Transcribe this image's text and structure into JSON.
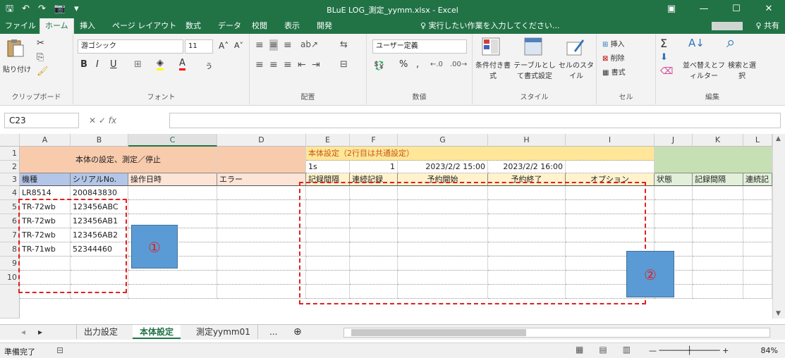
{
  "title": "BLuE LOG_測定_yymm.xlsx - Excel",
  "qat": {
    "save": "🖫",
    "undo": "↶",
    "redo": "↷",
    "camera": "📷",
    "more": "▾"
  },
  "window": {
    "restore_icon": "▣",
    "min": "—",
    "max": "☐",
    "close": "✕"
  },
  "tabs": [
    "ファイル",
    "ホーム",
    "挿入",
    "ページ レイアウト",
    "数式",
    "データ",
    "校閲",
    "表示",
    "開発"
  ],
  "active_tab": "ホーム",
  "tellme": "♀ 実行したい作業を入力してください...",
  "share": "♀ 共有",
  "ribbon": {
    "paste": "貼り付け",
    "clipboard": "クリップボード",
    "font_name": "游ゴシック",
    "font_size": "11",
    "font_group": "フォント",
    "bold": "B",
    "italic": "I",
    "underline": "U",
    "align_group": "配置",
    "number_format": "ユーザー定義",
    "percent": "%",
    "comma": ",",
    "number_group": "数値",
    "cond_format": "条件付き書式",
    "table_format": "テーブルとして書式設定",
    "cell_style": "セルのスタイル",
    "style_group": "スタイル",
    "insert": "挿入",
    "delete": "削除",
    "format": "書式",
    "cell_group": "セル",
    "sort_filter": "並べ替えとフィルター",
    "find_select": "検索と選択",
    "edit_group": "編集"
  },
  "formula_bar": {
    "name_box": "C23",
    "fx": "fx",
    "formula": ""
  },
  "columns": [
    "A",
    "B",
    "C",
    "D",
    "E",
    "F",
    "G",
    "H",
    "I",
    "J",
    "K",
    "L"
  ],
  "selected_column": "C",
  "rows": [
    "1",
    "2",
    "3",
    "4",
    "5",
    "6",
    "7",
    "8",
    "9",
    "10"
  ],
  "cells": {
    "r1_left": "本体の設定、測定／停止",
    "r1_main": "本体設定（2行目は共通設定）",
    "r2": {
      "E": "1s",
      "F": "1",
      "G": "2023/2/2 15:00",
      "H": "2023/2/2 16:00"
    },
    "r3": {
      "A": "機種",
      "B": "シリアルNo.",
      "C": "操作日時",
      "D": "エラー",
      "E": "記録間隔",
      "F": "連続記録",
      "G": "予約開始",
      "H": "予約終了",
      "I": "オプション",
      "J": "状態",
      "K": "記録間隔",
      "L": "連続記"
    },
    "data_rows": [
      {
        "model": "LR8514",
        "serial": "200843830"
      },
      {
        "model": "TR-72wb",
        "serial": "123456ABC"
      },
      {
        "model": "TR-72wb",
        "serial": "123456AB1"
      },
      {
        "model": "TR-72wb",
        "serial": "123456AB2"
      },
      {
        "model": "TR-71wb",
        "serial": "52344460"
      }
    ]
  },
  "callouts": {
    "one": "①",
    "two": "②"
  },
  "sheets": [
    "出力設定",
    "本体設定",
    "測定yymm01",
    "..."
  ],
  "active_sheet": "本体設定",
  "status": {
    "ready": "準備完了",
    "zoom": "84%"
  },
  "colors": {
    "excel_green": "#217346",
    "header_orange": "#f8cbad",
    "header_yellow": "#ffe699",
    "header_green": "#c6e0b4",
    "model_blue": "#b4c6e7",
    "callout_blue": "#5b9bd5",
    "dash_red": "#e02020"
  }
}
